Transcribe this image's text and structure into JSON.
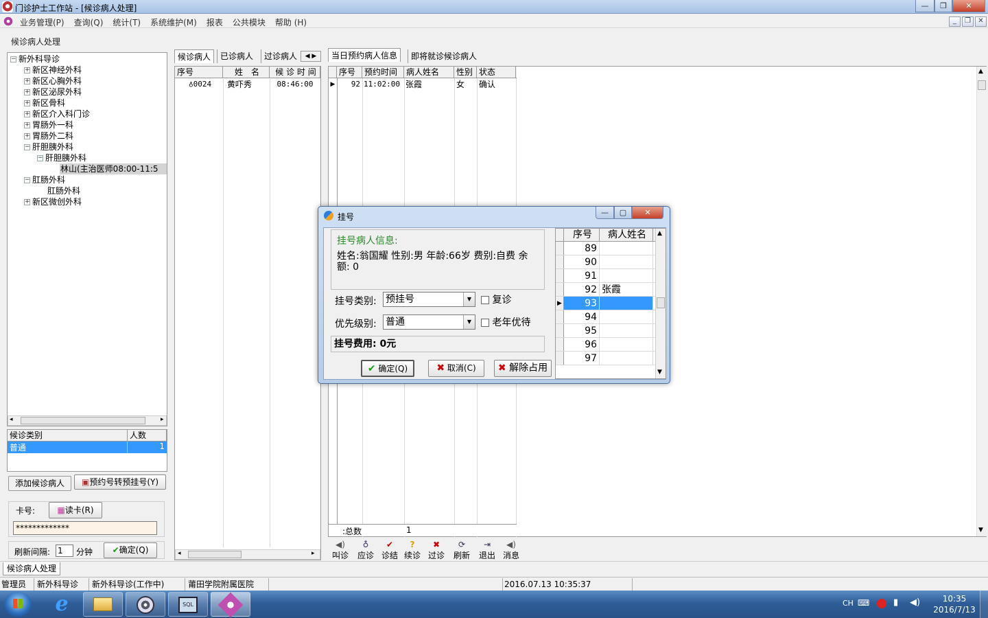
{
  "window": {
    "title": "门诊护士工作站 - [候诊病人处理]"
  },
  "menu": [
    "业务管理(P)",
    "查询(Q)",
    "统计(T)",
    "系统维护(M)",
    "报表",
    "公共模块",
    "帮助 (H)"
  ],
  "page_header": "候诊病人处理",
  "tree": {
    "root": "新外科导诊",
    "items": [
      {
        "label": "新区神经外科",
        "state": "+"
      },
      {
        "label": "新区心胸外科",
        "state": "+"
      },
      {
        "label": "新区泌尿外科",
        "state": "+"
      },
      {
        "label": "新区骨科",
        "state": "+"
      },
      {
        "label": "新区介入科门诊",
        "state": "+"
      },
      {
        "label": "胃肠外一科",
        "state": "+"
      },
      {
        "label": "胃肠外二科",
        "state": "+"
      },
      {
        "label": "肝胆胰外科",
        "state": "-"
      },
      {
        "label": "肝胆胰外科",
        "state": "-"
      },
      {
        "label": "林山(主治医师08:00-11:5",
        "state": ""
      },
      {
        "label": "肛肠外科",
        "state": "-"
      },
      {
        "label": "肛肠外科",
        "state": ""
      },
      {
        "label": "新区微创外科",
        "state": "+"
      }
    ]
  },
  "wait_type_table": {
    "headers": [
      "候诊类别",
      "人数"
    ],
    "rows": [
      {
        "type": "普通",
        "count": "1"
      }
    ]
  },
  "left_buttons": {
    "add": "添加候诊病人",
    "convert": "预约号转预挂号(Y)"
  },
  "card": {
    "label": "卡号:",
    "read_button": "读卡(R)",
    "value": "*************"
  },
  "refresh": {
    "label": "刷新间隔:",
    "value": "1",
    "unit": "分钟",
    "confirm": "确定(Q)"
  },
  "mid_tabs": [
    "候诊病人",
    "已诊病人",
    "过诊病人"
  ],
  "mid_grid": {
    "headers": [
      "序号",
      "姓　名",
      "候 诊 时 间"
    ],
    "rows": [
      {
        "no": "0024",
        "name": "黄吓秀",
        "time": "08:46:00"
      }
    ]
  },
  "right_tabs": [
    "当日预约病人信息",
    "即将就诊候诊病人"
  ],
  "right_grid": {
    "headers": [
      "序号",
      "预约时间",
      "病人姓名",
      "性别",
      "状态"
    ],
    "rows": [
      {
        "no": "92",
        "time": "11:02:00",
        "name": "张霞",
        "sex": "女",
        "status": "确认"
      }
    ],
    "footer_label": "总数:",
    "footer_value": "1"
  },
  "toolbar": [
    "叫诊",
    "应诊",
    "诊结",
    "续诊",
    "过诊",
    "刷新",
    "退出",
    "消息"
  ],
  "bottom_tab": "候诊病人处理",
  "statusbar": [
    "管理员",
    "新外科导诊",
    "新外科导诊(工作中)",
    "莆田学院附属医院",
    "2016.07.13 10:35:37"
  ],
  "dialog": {
    "title": "挂号",
    "info_title": "挂号病人信息:",
    "info_text": "姓名:翁国耀 性别:男 年龄:66岁 费别:自费 余额: 0",
    "reg_type_label": "挂号类别:",
    "reg_type_value": "预挂号",
    "revisit_label": "复诊",
    "priority_label": "优先级别:",
    "priority_value": "普通",
    "elder_label": "老年优待",
    "fee_text": "挂号费用: 0元",
    "ok": "确定(Q)",
    "cancel": "取消(C)",
    "release": "解除占用",
    "num_grid": {
      "headers": [
        "序号",
        "病人姓名"
      ],
      "rows": [
        {
          "no": "89",
          "name": ""
        },
        {
          "no": "90",
          "name": ""
        },
        {
          "no": "91",
          "name": ""
        },
        {
          "no": "92",
          "name": "张霞"
        },
        {
          "no": "93",
          "name": ""
        },
        {
          "no": "94",
          "name": ""
        },
        {
          "no": "95",
          "name": ""
        },
        {
          "no": "96",
          "name": ""
        },
        {
          "no": "97",
          "name": ""
        }
      ]
    }
  },
  "tray": {
    "lang": "CH",
    "time": "10:35",
    "date": "2016/7/13"
  },
  "colors": {
    "selection": "#3399ff",
    "dialog_green": "#2a8a2a",
    "input_bg": "#fdf3e6"
  }
}
